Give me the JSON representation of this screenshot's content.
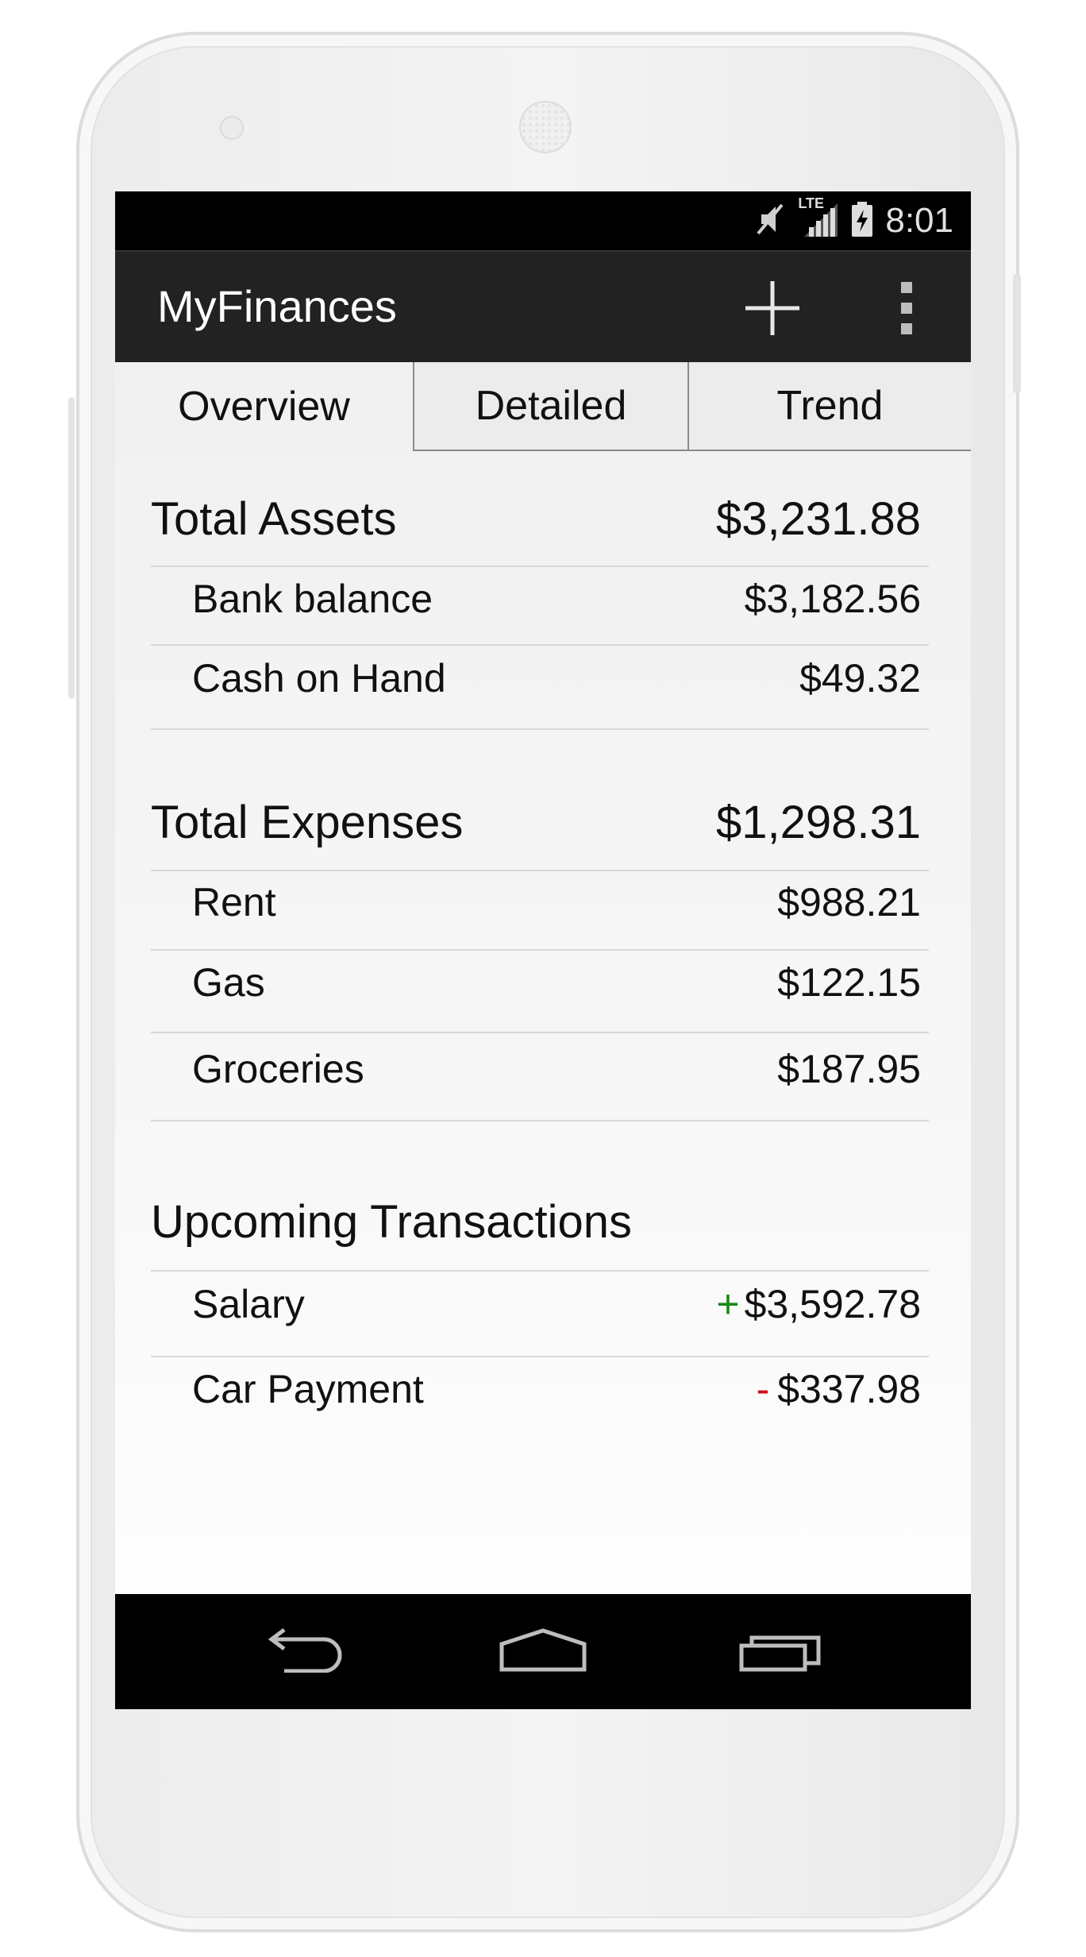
{
  "status": {
    "time": "8:01",
    "network": "LTE",
    "icons": [
      "mute-icon",
      "signal-icon",
      "battery-charging-icon"
    ]
  },
  "app": {
    "title": "MyFinances",
    "actions": [
      "add-icon",
      "overflow-menu-icon"
    ]
  },
  "tabs": [
    {
      "label": "Overview",
      "selected": true
    },
    {
      "label": "Detailed",
      "selected": false
    },
    {
      "label": "Trend",
      "selected": false
    }
  ],
  "assets": {
    "title": "Total Assets",
    "total": "$3,231.88",
    "items": [
      {
        "label": "Bank balance",
        "value": "$3,182.56"
      },
      {
        "label": "Cash on Hand",
        "value": "$49.32"
      }
    ]
  },
  "expenses": {
    "title": "Total Expenses",
    "total": "$1,298.31",
    "items": [
      {
        "label": "Rent",
        "value": "$988.21"
      },
      {
        "label": "Gas",
        "value": "$122.15"
      },
      {
        "label": "Groceries",
        "value": "$187.95"
      }
    ]
  },
  "upcoming": {
    "title": "Upcoming Transactions",
    "items": [
      {
        "label": "Salary",
        "sign": "+",
        "value": "$3,592.78"
      },
      {
        "label": "Car Payment",
        "sign": "-",
        "value": "$337.98"
      }
    ]
  },
  "colors": {
    "positive": "#1a8a1a",
    "negative": "#cc1111",
    "actionbar": "#222222"
  },
  "nav": [
    "back-icon",
    "home-icon",
    "recents-icon"
  ]
}
